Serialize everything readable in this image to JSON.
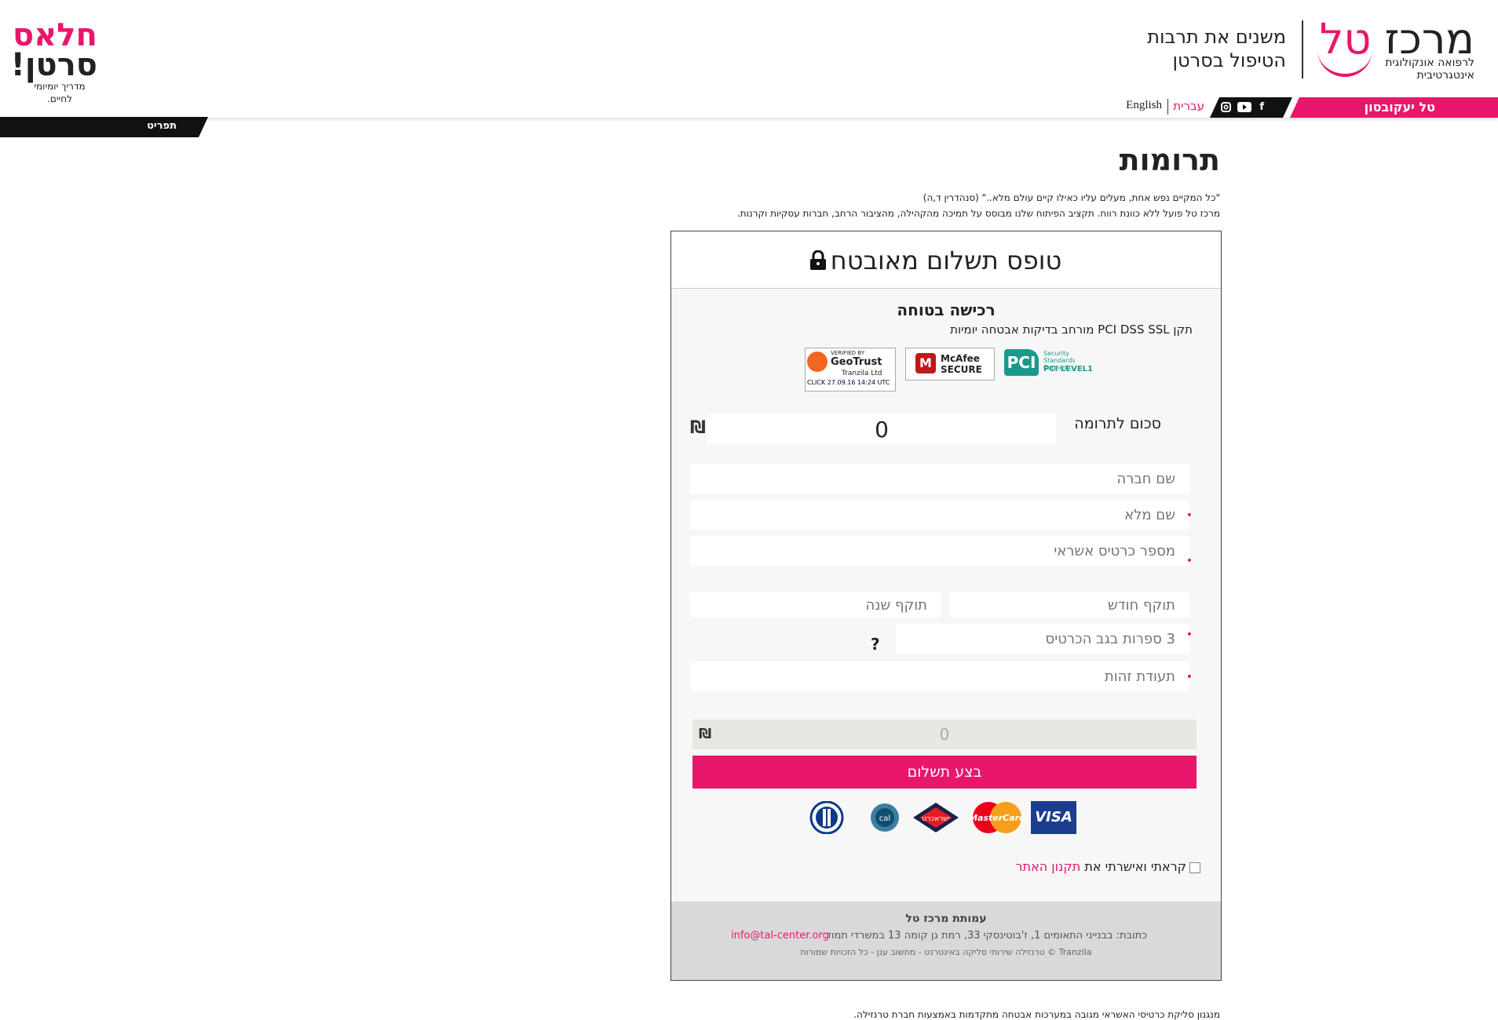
{
  "header": {
    "logo_main_black": "מרכז",
    "logo_main_pink": "טל",
    "logo_sub": "לרפואה אונקולוגית\nאינטגרטיבית",
    "tagline_1": "משנים את תרבות",
    "tagline_2": "הטיפול בסרטן",
    "left_logo_1": "חלאס",
    "left_logo_2": "סרטן!",
    "left_logo_3": "מדריך יומיומי לחיים.",
    "person_link": "טל יעקובסון",
    "lang_he": "עברית",
    "lang_en": "English",
    "menu_label": "תפריט",
    "social_icons": [
      "facebook-icon",
      "youtube-icon",
      "instagram-icon"
    ]
  },
  "page": {
    "title": "תרומות",
    "quote": "\"כל המקיים נפש אחת, מעלים עליו כאילו קיים עולם מלא..\" (סנהדרין ד,ה)",
    "intro": "מרכז טל פועל ללא כוונת רווח. תקציב הפיתוח שלנו מבוסס על תמיכה מהקהילה, מהציבור הרחב, חברות עסקיות וקרנות.",
    "bottom_note": "מנגנון סליקת כרטיסי האשראי מגובה במערכות אבטחה מתקדמות באמצעות חברת טרנזילה."
  },
  "form": {
    "header_title": "טופס תשלום מאובטח",
    "secure_title": "רכישה בטוחה",
    "secure_sub": "תקן PCI DSS  SSL מורחב  בדיקות אבטחה יומיות",
    "badges": {
      "geotrust_1": "VERIFIED BY",
      "geotrust_2": "GeoTrust",
      "geotrust_3": "Tranzila Ltd",
      "geotrust_4": "CLICK 27.09.16 14:24 UTC",
      "mcafee": "McAfee SECURE",
      "pci_1": "PCI",
      "pci_2": "Security Standards Council",
      "pci_3": "PCI LEVEL1"
    },
    "amount_label": "סכום לתרומה",
    "amount_value": "0",
    "currency": "₪",
    "company_placeholder": "שם חברה",
    "fullname_placeholder": "שם מלא",
    "card_placeholder": "מספר כרטיס אשראי",
    "month_placeholder": "תוקף חודש",
    "year_placeholder": "תוקף שנה",
    "cvv_placeholder": "3 ספרות בגב הכרטיס",
    "cvv_help": "?",
    "id_placeholder": "תעודת זהות",
    "total_value": "0",
    "pay_button": "בצע תשלום",
    "card_logos": [
      "VISA",
      "MasterCard",
      "ישראכרט",
      "cal",
      "Diners"
    ],
    "terms_prefix": "קראתי ואישרתי את ",
    "terms_link": "תקנון האתר",
    "footer_title": "עמותת מרכז טל",
    "footer_address": "כתובת: בבנייני התאומים 1, ז'בוטינסקי 33, רמת גן קומה 13 במשרדי תמוז",
    "footer_email": "info@tal-center.org",
    "footer_copy": "Tranzila © טרנזילה שירותי סליקה באינטרנט - מחשוב ענן - כל הזכויות שמורות"
  },
  "colors": {
    "accent": "#e8176c",
    "dark": "#111111"
  }
}
